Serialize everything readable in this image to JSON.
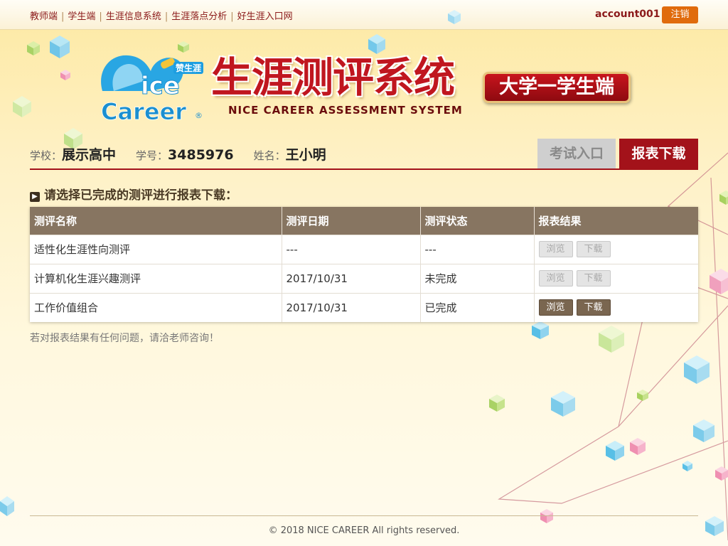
{
  "topnav": {
    "items": [
      "教师端",
      "学生端",
      "生涯信息系统",
      "生涯落点分析",
      "好生涯入口网"
    ],
    "separator": "|"
  },
  "account": {
    "username": "account001",
    "logout_label": "注销"
  },
  "header": {
    "logo_tag": "赞生涯",
    "logo_text_line1": "ice",
    "logo_text_line2": "Career",
    "logo_mark": "®",
    "title": "生涯测评系统",
    "subtitle": "NICE CAREER ASSESSMENT SYSTEM",
    "role_badge": "大学一学生端"
  },
  "student": {
    "school_label": "学校：",
    "school": "展示高中",
    "id_label": "学号：",
    "id": "3485976",
    "name_label": "姓名：",
    "name": "王小明"
  },
  "tabs": {
    "exam": "考试入口",
    "report": "报表下载"
  },
  "section": {
    "arrow": "▶",
    "heading": "请选择已完成的测评进行报表下载："
  },
  "table": {
    "columns": [
      "测评名称",
      "测评日期",
      "测评状态",
      "报表结果"
    ],
    "rows": [
      {
        "name": "适性化生涯性向测评",
        "date": "---",
        "status": "---",
        "view": "浏览",
        "download": "下载",
        "enabled": false
      },
      {
        "name": "计算机化生涯兴趣测评",
        "date": "2017/10/31",
        "status": "未完成",
        "view": "浏览",
        "download": "下载",
        "enabled": false
      },
      {
        "name": "工作价值组合",
        "date": "2017/10/31",
        "status": "已完成",
        "view": "浏览",
        "download": "下载",
        "enabled": true
      }
    ]
  },
  "note": "若对报表结果有任何问题，请洽老师咨询！",
  "footer": "© 2018 NICE CAREER All rights reserved.",
  "colors": {
    "brand_red": "#a3121a",
    "header_brown": "#877561",
    "logout_orange": "#e06b0c",
    "logo_blue": "#1d9ee0"
  }
}
